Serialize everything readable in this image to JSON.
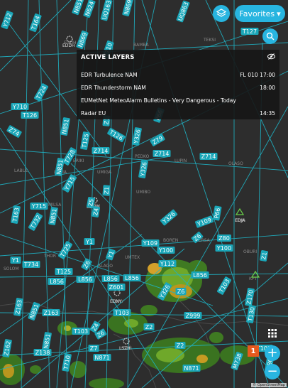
{
  "toolbar": {
    "favorites_label": "Favorites",
    "favorites_caret": "▾",
    "layers_icon": "layers-icon",
    "search_icon": "search-icon"
  },
  "active_layers": {
    "title": "ACTIVE LAYERS",
    "items": [
      {
        "name": "EDR Turbulence NAM",
        "meta": "FL 010 17:00"
      },
      {
        "name": "EDR Thunderstorm NAM",
        "meta": "18:00"
      },
      {
        "name": "EUMetNet MeteoAlarm Bulletins - Very Dangerous - Today",
        "meta": ""
      },
      {
        "name": "Radar EU",
        "meta": "14:35"
      }
    ]
  },
  "map": {
    "route_labels": [
      {
        "text": "Y712"
      },
      {
        "text": "T164"
      },
      {
        "text": "N851"
      },
      {
        "text": "N624"
      },
      {
        "text": "UQ163"
      },
      {
        "text": "N869"
      },
      {
        "text": "UQ863"
      },
      {
        "text": "T127"
      },
      {
        "text": "N869"
      },
      {
        "text": "T710"
      },
      {
        "text": "T724"
      },
      {
        "text": "Y710"
      },
      {
        "text": "T126"
      },
      {
        "text": "N851"
      },
      {
        "text": "Z74"
      },
      {
        "text": "Z1"
      },
      {
        "text": "T126"
      },
      {
        "text": "Y326"
      },
      {
        "text": "Z79"
      },
      {
        "text": "P66"
      },
      {
        "text": "Z714"
      },
      {
        "text": "Z714"
      },
      {
        "text": "Z714"
      },
      {
        "text": "T125"
      },
      {
        "text": "T728"
      },
      {
        "text": "N851"
      },
      {
        "text": "Y715"
      },
      {
        "text": "Y326"
      },
      {
        "text": "Z1"
      },
      {
        "text": "Y715"
      },
      {
        "text": "T163"
      },
      {
        "text": "T732"
      },
      {
        "text": "N851"
      },
      {
        "text": "Z4"
      },
      {
        "text": "Z5"
      },
      {
        "text": "Y326"
      },
      {
        "text": "Y109"
      },
      {
        "text": "P66"
      },
      {
        "text": "Y1"
      },
      {
        "text": "T734"
      },
      {
        "text": "Y1"
      },
      {
        "text": "T725"
      },
      {
        "text": "Y109"
      },
      {
        "text": "Y100"
      },
      {
        "text": "Y100"
      },
      {
        "text": "Z6"
      },
      {
        "text": "Z6"
      },
      {
        "text": "T125"
      },
      {
        "text": "L856"
      },
      {
        "text": "Y112"
      },
      {
        "text": "L856"
      },
      {
        "text": "L856"
      },
      {
        "text": "L856"
      },
      {
        "text": "L856"
      },
      {
        "text": "Z601"
      },
      {
        "text": "Z6"
      },
      {
        "text": "Y326"
      },
      {
        "text": "T103"
      },
      {
        "text": "Z999"
      },
      {
        "text": "Z170"
      },
      {
        "text": "Z163"
      },
      {
        "text": "Z163"
      },
      {
        "text": "T103"
      },
      {
        "text": "N851"
      },
      {
        "text": "T103"
      },
      {
        "text": "Z6"
      },
      {
        "text": "Z162"
      },
      {
        "text": "Z138"
      },
      {
        "text": "T710"
      },
      {
        "text": "Z7"
      },
      {
        "text": "Z2"
      },
      {
        "text": "N871"
      },
      {
        "text": "N871"
      },
      {
        "text": "T103"
      },
      {
        "text": "M738"
      },
      {
        "text": "T130"
      },
      {
        "text": "N869"
      },
      {
        "text": "Z2"
      },
      {
        "text": "Z4"
      },
      {
        "text": "N851"
      },
      {
        "text": "Z80"
      },
      {
        "text": "Y1"
      },
      {
        "text": "Z1"
      }
    ],
    "place_labels": [
      "EDDH",
      "BAMBA",
      "TEKSI",
      "LABUL",
      "LUGIA",
      "ERIKI",
      "UMIGA",
      "PEDKO",
      "UMIBO",
      "LUPIN",
      "OLASO",
      "MILSA",
      "EDTM",
      "EDJA",
      "OBURI",
      "BOREN",
      "GERSA",
      "THOR",
      "SOLOM",
      "ALAGO",
      "UMTEX",
      "EDNY",
      "LSZH",
      "KPT",
      "LSZ?",
      "EDDM"
    ],
    "airport_codes": [
      "EDDH",
      "EDTM",
      "EDJA",
      "EDNY",
      "LSZH"
    ],
    "attribution": "© OpenStreetMap"
  },
  "zoom": {
    "plus": "+",
    "minus": "−",
    "notification_count": "1"
  },
  "colors": {
    "accent": "#28b5e0",
    "route_line": "#1fb4c6",
    "route_label_bg": "#1aa6b8",
    "panel_bg": "#161616",
    "badge": "#e65a1e",
    "land": "#2c2c2c"
  }
}
